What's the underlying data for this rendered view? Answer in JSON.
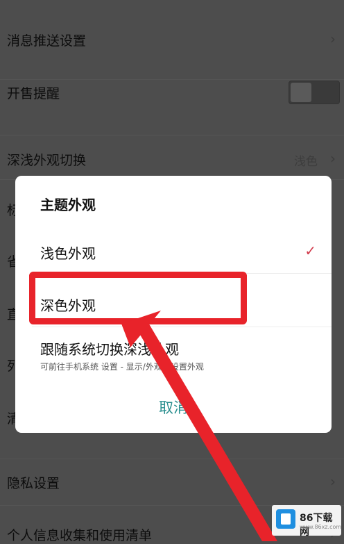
{
  "settings": {
    "rows": [
      {
        "label": "消息推送设置",
        "chevron": "›"
      },
      {
        "label": "开售提醒"
      },
      {
        "label": "深浅外观切换",
        "value": "浅色",
        "chevron": "›"
      },
      {
        "label": "隐私设置",
        "chevron": "›"
      },
      {
        "label": "个人信息收集和使用清单",
        "chevron": "›"
      }
    ],
    "clipped": [
      "标",
      "省",
      "直",
      "列",
      "清"
    ]
  },
  "dialog": {
    "title": "主题外观",
    "options": [
      {
        "label": "浅色外观",
        "checkmark": "✓",
        "selected": true
      },
      {
        "label": "深色外观",
        "selected": false
      },
      {
        "label": "跟随系统切换深浅外观",
        "subtext": "可前往手机系统 设置 - 显示/外观，设置外观",
        "selected": false
      }
    ],
    "cancel": "取消"
  },
  "watermark": {
    "text": "86下载网",
    "url": "www.86xz.com"
  },
  "colors": {
    "overlay": "#4d4d4d",
    "dialog_bg": "#ffffff",
    "check": "#d23c4d",
    "cancel": "#2a8f8f",
    "annotation": "#e8232a"
  },
  "icons": {
    "chevron": "chevron-right-icon",
    "check": "check-icon",
    "arrow": "annotation-arrow"
  }
}
